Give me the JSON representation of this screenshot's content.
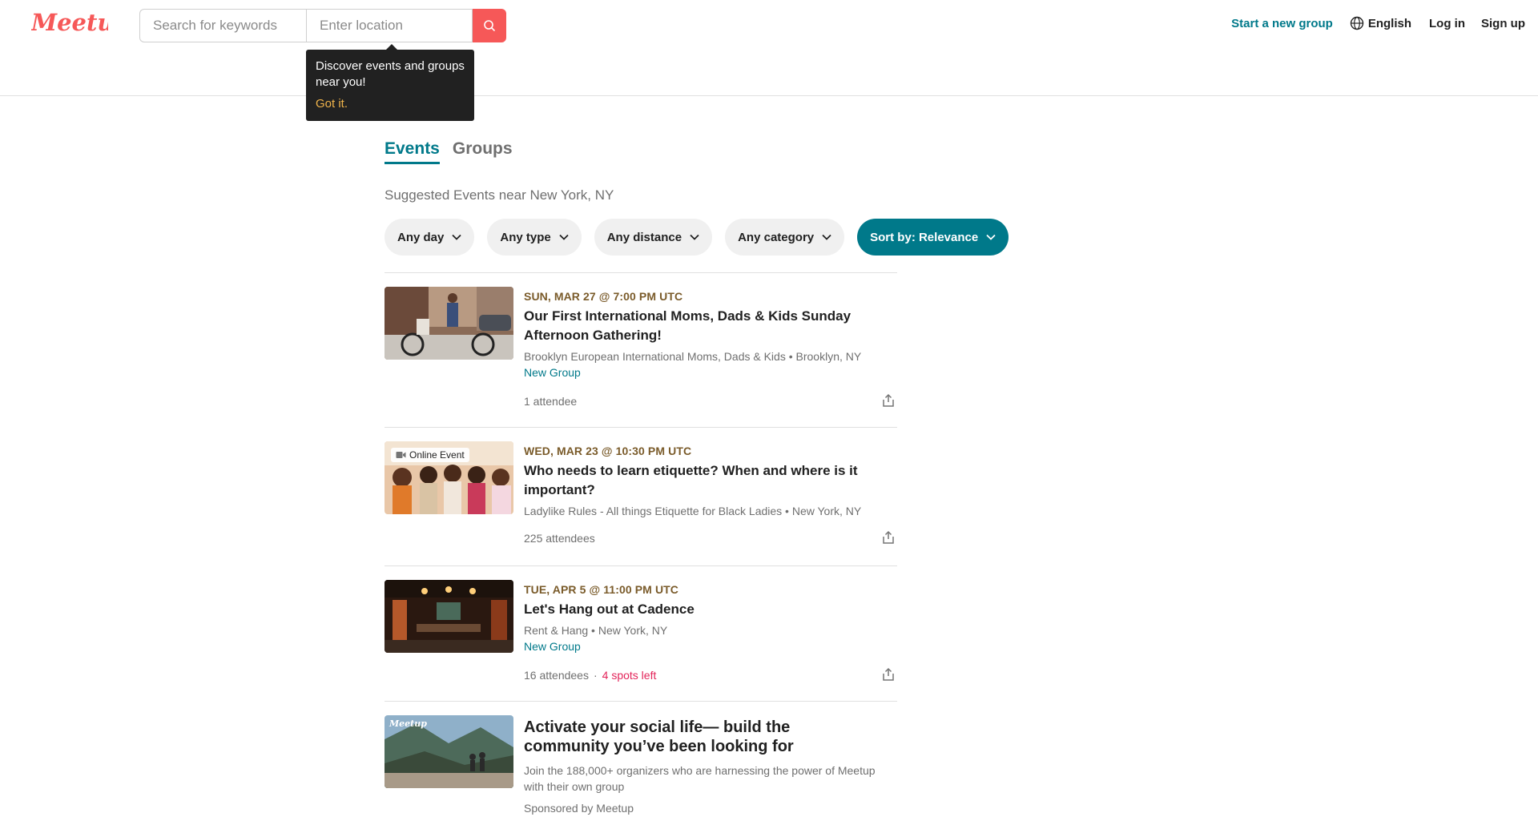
{
  "header": {
    "logo_text": "Meetup",
    "search_placeholder": "Search for keywords",
    "location_placeholder": "Enter location",
    "start_group": "Start a new group",
    "language": "English",
    "login": "Log in",
    "signup": "Sign up"
  },
  "tooltip": {
    "text": "Discover events and groups near you!",
    "link": "Got it."
  },
  "tabs": [
    "Events",
    "Groups"
  ],
  "subtitle": "Suggested Events near New York, NY",
  "filters": [
    "Any day",
    "Any type",
    "Any distance",
    "Any category",
    "Sort by: Relevance"
  ],
  "events": [
    {
      "date": "SUN, MAR 27 @ 7:00 PM UTC",
      "title": "Our First International Moms, Dads & Kids Sunday Afternoon Gathering!",
      "group": "Brooklyn European International Moms, Dads & Kids • Brooklyn, NY",
      "new_group": "New Group",
      "attendees": "1 attendee"
    },
    {
      "date": "WED, MAR 23 @ 10:30 PM UTC",
      "title": "Who needs to learn etiquette? When and where is it important?",
      "group": "Ladylike Rules - All things Etiquette for Black Ladies • New York, NY",
      "badge": "Online Event",
      "attendees": "225 attendees"
    },
    {
      "date": "TUE, APR 5 @ 11:00 PM UTC",
      "title": "Let's Hang out at Cadence",
      "group": "Rent & Hang • New York, NY",
      "new_group": "New Group",
      "attendees": "16 attendees",
      "separator": "·",
      "spots": "4 spots left"
    }
  ],
  "promo": {
    "image_logo": "Meetup",
    "title": "Activate your social life— build the community you’ve been looking for",
    "description": "Join the 188,000+ organizers who are harnessing the power of Meetup with their own group",
    "sponsor": "Sponsored by Meetup"
  },
  "colors": {
    "brand": "#f65858",
    "accent": "#00798a",
    "date": "#7a5b2a",
    "spots": "#e32359"
  }
}
